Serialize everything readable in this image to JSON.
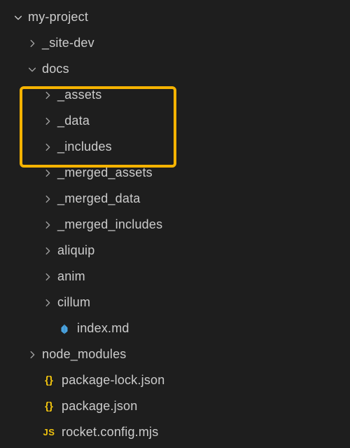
{
  "root": {
    "name": "my-project"
  },
  "rows": [
    {
      "name": "_site-dev",
      "depth": 1,
      "icon": "chev-right",
      "file": null
    },
    {
      "name": "docs",
      "depth": 1,
      "icon": "chev-down",
      "file": null
    },
    {
      "name": "_assets",
      "depth": 2,
      "icon": "chev-right",
      "file": null,
      "hl": true
    },
    {
      "name": "_data",
      "depth": 2,
      "icon": "chev-right",
      "file": null,
      "hl": true
    },
    {
      "name": "_includes",
      "depth": 2,
      "icon": "chev-right",
      "file": null,
      "hl": true
    },
    {
      "name": "_merged_assets",
      "depth": 2,
      "icon": "chev-right",
      "file": null
    },
    {
      "name": "_merged_data",
      "depth": 2,
      "icon": "chev-right",
      "file": null
    },
    {
      "name": "_merged_includes",
      "depth": 2,
      "icon": "chev-right",
      "file": null
    },
    {
      "name": "aliquip",
      "depth": 2,
      "icon": "chev-right",
      "file": null
    },
    {
      "name": "anim",
      "depth": 2,
      "icon": "chev-right",
      "file": null
    },
    {
      "name": "cillum",
      "depth": 2,
      "icon": "chev-right",
      "file": null
    },
    {
      "name": "index.md",
      "depth": 2,
      "icon": null,
      "file": "markdown"
    },
    {
      "name": "node_modules",
      "depth": 1,
      "icon": "chev-right",
      "file": null
    },
    {
      "name": "package-lock.json",
      "depth": 1,
      "icon": null,
      "file": "json"
    },
    {
      "name": "package.json",
      "depth": 1,
      "icon": null,
      "file": "json"
    },
    {
      "name": "rocket.config.mjs",
      "depth": 1,
      "icon": null,
      "file": "js"
    }
  ]
}
